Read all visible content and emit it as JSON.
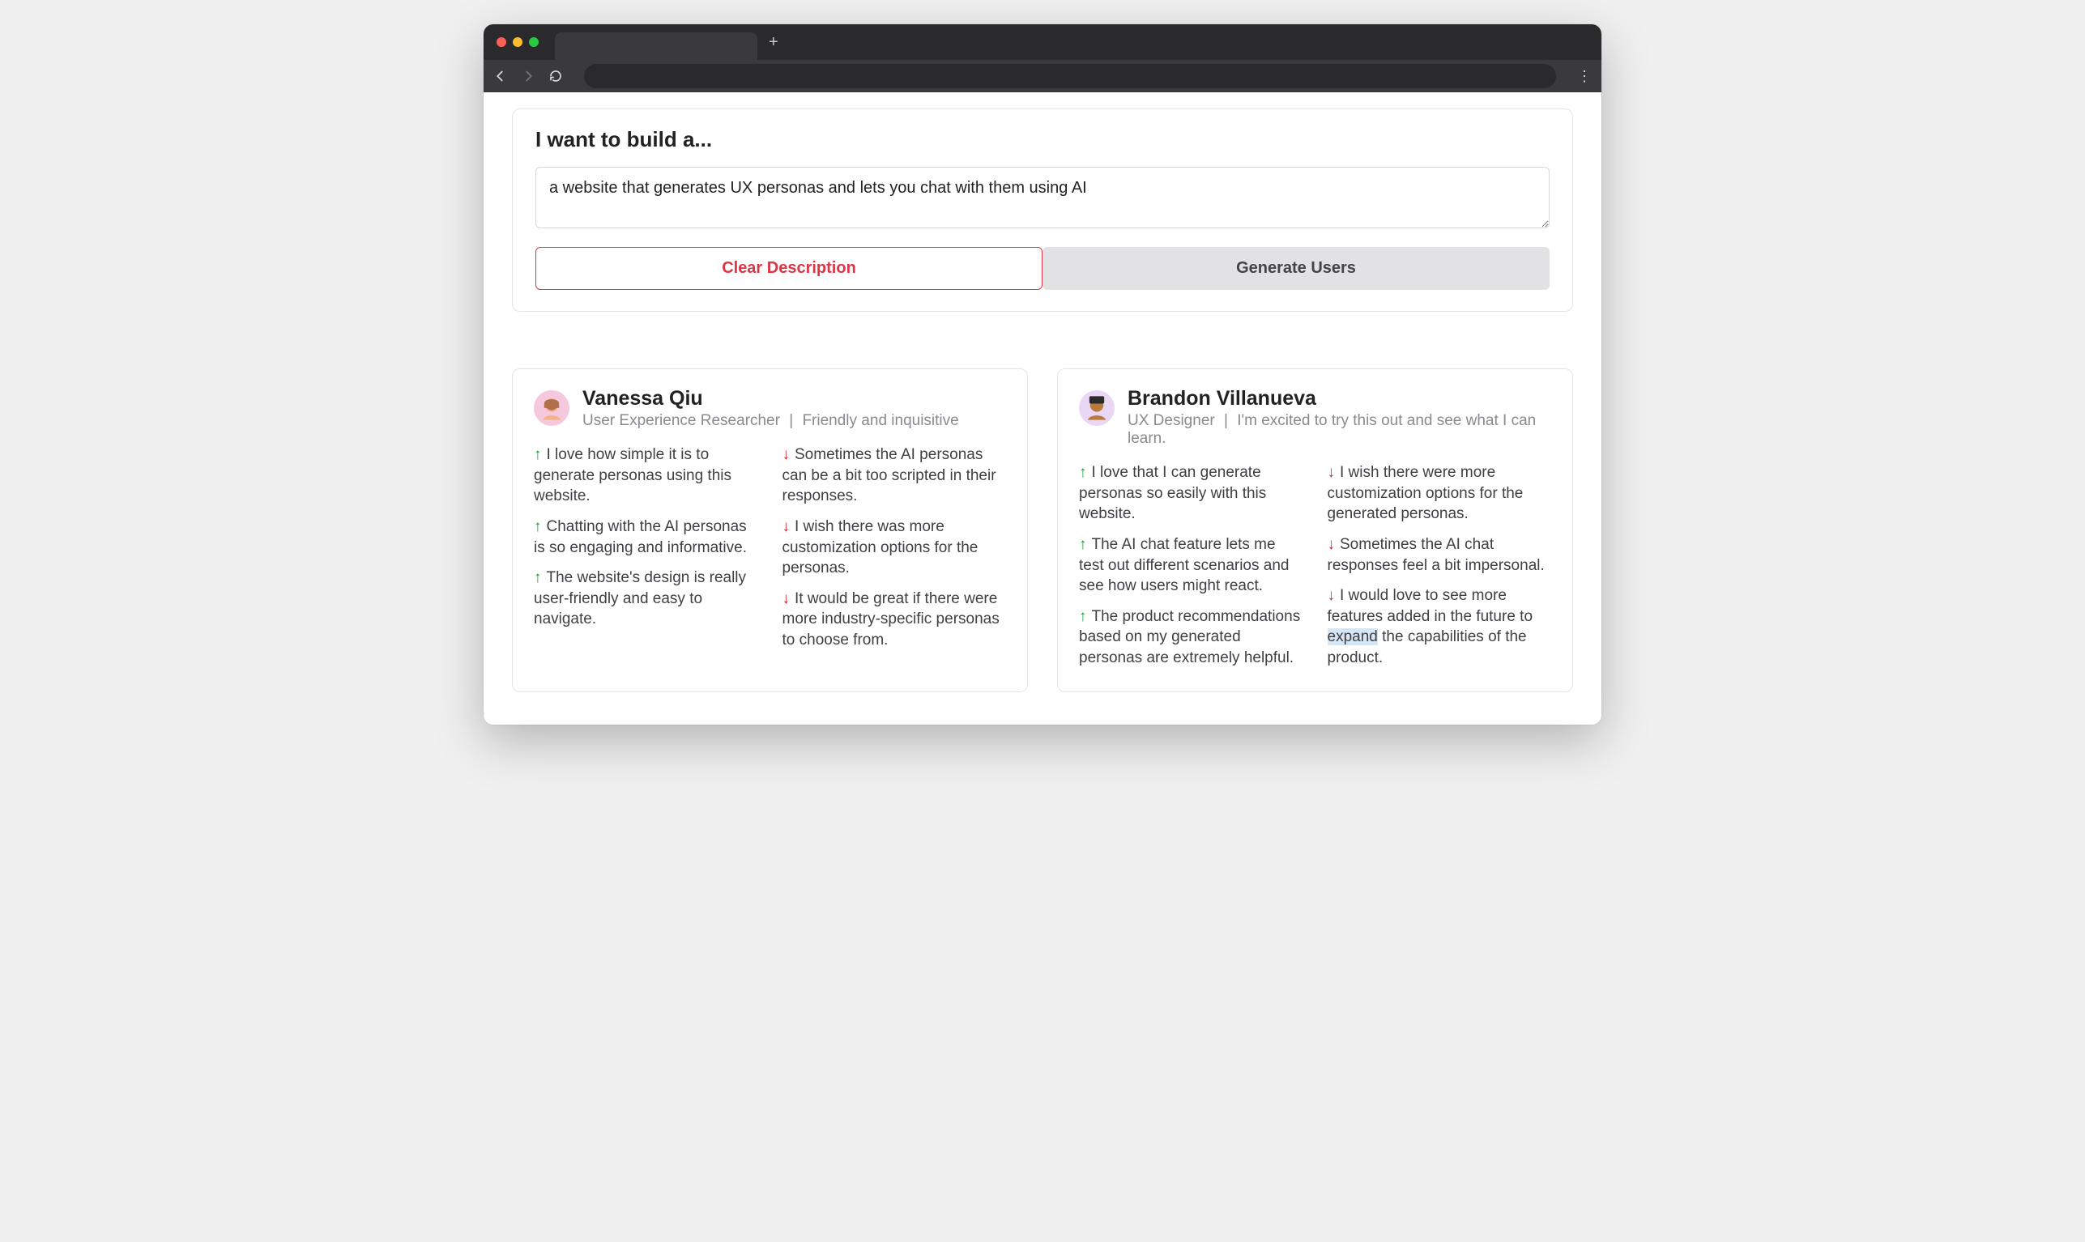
{
  "prompt": {
    "title": "I want to build a...",
    "input_value": "a website that generates UX personas and lets you chat with them using AI",
    "clear_label": "Clear Description",
    "generate_label": "Generate Users"
  },
  "personas": [
    {
      "name": "Vanessa Qiu",
      "role": "User Experience Researcher",
      "trait": "Friendly and inquisitive",
      "pros": [
        "I love how simple it is to generate personas using this website.",
        "Chatting with the AI personas is so engaging and informative.",
        "The website's design is really user-friendly and easy to navigate."
      ],
      "cons": [
        "Sometimes the AI personas can be a bit too scripted in their responses.",
        "I wish there was more customization options for the personas.",
        "It would be great if there were more industry-specific personas to choose from."
      ]
    },
    {
      "name": "Brandon Villanueva",
      "role": "UX Designer",
      "trait": "I'm excited to try this out and see what I can learn.",
      "pros": [
        "I love that I can generate personas so easily with this website.",
        "The AI chat feature lets me test out different scenarios and see how users might react.",
        "The product recommendations based on my generated personas are extremely helpful."
      ],
      "cons": [
        "I wish there were more customization options for the generated personas.",
        "Sometimes the AI chat responses feel a bit impersonal.",
        "I would love to see more features added in the future to expand the capabilities of the product."
      ],
      "highlight_word": "expand"
    }
  ]
}
